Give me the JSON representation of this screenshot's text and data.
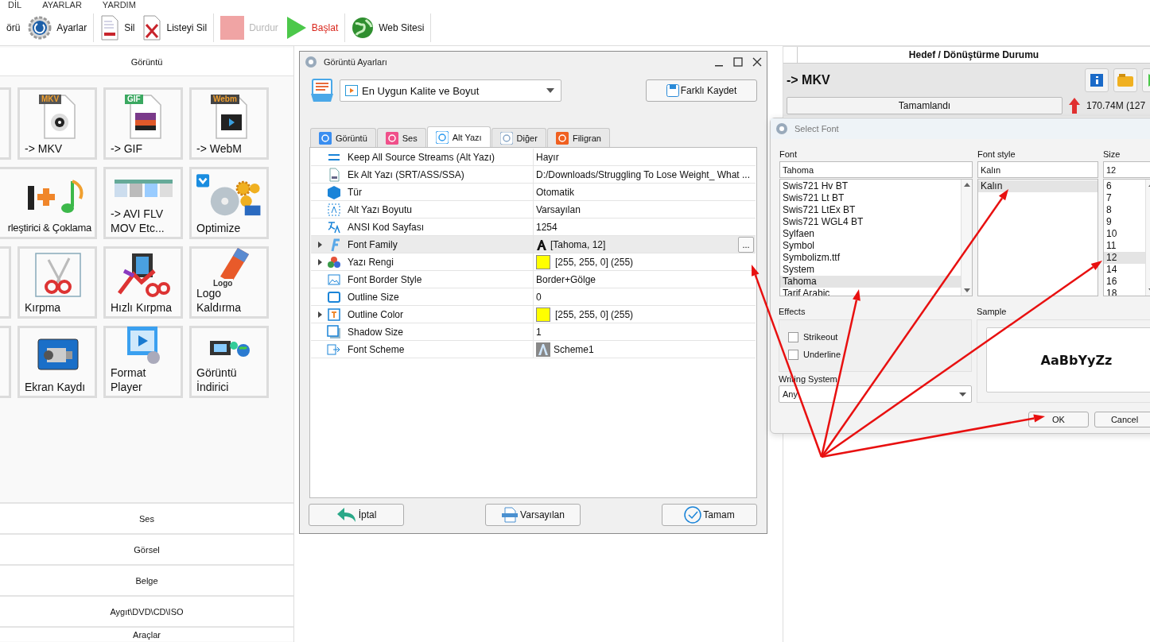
{
  "menu": [
    "DİL",
    "AYARLAR",
    "YARDIM"
  ],
  "toolbar": [
    [
      {
        "kind": "cut",
        "label": "örü",
        "disabled": false,
        "highlighted": false
      },
      {
        "kind": "settings",
        "label": "Ayarlar",
        "disabled": false,
        "highlighted": false
      }
    ],
    [
      {
        "kind": "delete",
        "label": "Sil",
        "disabled": false,
        "highlighted": false
      },
      {
        "kind": "clear",
        "label": "Listeyi Sil",
        "disabled": false,
        "highlighted": false
      }
    ],
    [
      {
        "kind": "stop",
        "label": "Durdur",
        "disabled": true,
        "highlighted": false
      },
      {
        "kind": "start",
        "label": "Başlat",
        "disabled": false,
        "highlighted": true
      }
    ],
    [
      {
        "kind": "web",
        "label": "Web Sitesi",
        "disabled": false,
        "highlighted": false
      }
    ]
  ],
  "left_panel": {
    "header": "Görüntü",
    "tiles": [
      {
        "kind": "partial"
      },
      {
        "kind": "mkv",
        "badge": "MKV",
        "lines": [
          "-> MKV"
        ]
      },
      {
        "kind": "gif",
        "badge": "GIF",
        "lines": [
          "-> GIF"
        ]
      },
      {
        "kind": "webm",
        "badge": "Webm",
        "lines": [
          "-> WebM"
        ]
      },
      {
        "kind": "merge",
        "lines": [
          "rleştirici & Çoklama"
        ]
      },
      {
        "kind": "avi",
        "lines": [
          "-> AVI FLV",
          "MOV Etc..."
        ]
      },
      {
        "kind": "optimize",
        "lines": [
          "Optimize"
        ]
      },
      {
        "kind": "partial"
      },
      {
        "kind": "crop",
        "lines": [
          "Kırpma"
        ]
      },
      {
        "kind": "fastcrop",
        "lines": [
          "Hızlı Kırpma"
        ]
      },
      {
        "kind": "logo",
        "badge": "Logo",
        "lines": [
          "Logo",
          "Kaldırma"
        ]
      },
      {
        "kind": "partial"
      },
      {
        "kind": "record",
        "lines": [
          "Ekran Kaydı"
        ]
      },
      {
        "kind": "player",
        "lines": [
          "Format",
          "Player"
        ]
      },
      {
        "kind": "download",
        "lines": [
          "Görüntü",
          "İndirici"
        ]
      }
    ],
    "categories": [
      "Ses",
      "Görsel",
      "Belge",
      "Aygıt\\DVD\\CD\\ISO",
      "Araçlar"
    ]
  },
  "target_panel": {
    "header": "Hedef / Dönüştürme Durumu",
    "title": "-> MKV",
    "status": "Tamamlandı",
    "size": "170.74M  (127"
  },
  "settings_dialog": {
    "title": "Görüntü Ayarları",
    "profile": "En Uygun Kalite ve Boyut",
    "save_as": "Farklı Kaydet",
    "tabs": [
      {
        "label": "Görüntü",
        "selected": false
      },
      {
        "label": "Ses",
        "selected": false
      },
      {
        "label": "Alt Yazı",
        "selected": true
      },
      {
        "label": "Diğer",
        "selected": false
      },
      {
        "label": "Filigran",
        "selected": false
      }
    ],
    "properties": [
      {
        "name": "Keep All Source Streams (Alt Yazı)",
        "value": "Hayır",
        "kind": "text",
        "expandable": false,
        "selected": false
      },
      {
        "name": "Ek Alt Yazı (SRT/ASS/SSA)",
        "value": "D:/Downloads/Struggling To Lose Weight_ What ...",
        "kind": "text",
        "expandable": false,
        "selected": false
      },
      {
        "name": "Tür",
        "value": "Otomatik",
        "kind": "text",
        "expandable": false,
        "selected": false
      },
      {
        "name": "Alt Yazı Boyutu",
        "value": "Varsayılan",
        "kind": "text",
        "expandable": false,
        "selected": false
      },
      {
        "name": "ANSI Kod Sayfası",
        "value": "1254",
        "kind": "text",
        "expandable": false,
        "selected": false
      },
      {
        "name": "Font Family",
        "value": "[Tahoma, 12]",
        "kind": "font",
        "expandable": true,
        "selected": true
      },
      {
        "name": "Yazı Rengi",
        "value": "[255, 255, 0] (255)",
        "kind": "color",
        "color": "#ffff00",
        "expandable": true,
        "selected": false
      },
      {
        "name": "Font Border Style",
        "value": "Border+Gölge",
        "kind": "text",
        "expandable": false,
        "selected": false
      },
      {
        "name": "Outline Size",
        "value": "0",
        "kind": "text",
        "expandable": false,
        "selected": false
      },
      {
        "name": "Outline Color",
        "value": "[255, 255, 0] (255)",
        "kind": "color",
        "color": "#ffff00",
        "expandable": true,
        "selected": false
      },
      {
        "name": "Shadow Size",
        "value": "1",
        "kind": "text",
        "expandable": false,
        "selected": false
      },
      {
        "name": "Font Scheme",
        "value": "Scheme1",
        "kind": "scheme",
        "expandable": false,
        "selected": false
      }
    ],
    "edit_button": "...",
    "buttons": [
      {
        "kind": "cancel",
        "label": "İptal"
      },
      {
        "kind": "default",
        "label": "Varsayılan"
      },
      {
        "kind": "ok",
        "label": "Tamam"
      }
    ]
  },
  "font_dialog": {
    "title": "Select Font",
    "font": {
      "label": "Font",
      "value": "Tahoma",
      "items": [
        {
          "label": "Swis721 Hv BT",
          "selected": false
        },
        {
          "label": "Swis721 Lt BT",
          "selected": false
        },
        {
          "label": "Swis721 LtEx BT",
          "selected": false
        },
        {
          "label": "Swis721 WGL4 BT",
          "selected": false
        },
        {
          "label": "Sylfaen",
          "selected": false
        },
        {
          "label": "Symbol",
          "selected": false
        },
        {
          "label": "Symbolizm.ttf",
          "selected": false
        },
        {
          "label": "System",
          "selected": false
        },
        {
          "label": "Tahoma",
          "selected": true
        },
        {
          "label": "Tarif Arabic",
          "selected": false
        }
      ]
    },
    "style": {
      "label": "Font style",
      "value": "Kalın",
      "items": [
        {
          "label": "Kalın",
          "selected": true
        }
      ]
    },
    "size": {
      "label": "Size",
      "value": "12",
      "items": [
        {
          "label": "6",
          "selected": false
        },
        {
          "label": "7",
          "selected": false
        },
        {
          "label": "8",
          "selected": false
        },
        {
          "label": "9",
          "selected": false
        },
        {
          "label": "10",
          "selected": false
        },
        {
          "label": "11",
          "selected": false
        },
        {
          "label": "12",
          "selected": true
        },
        {
          "label": "14",
          "selected": false
        },
        {
          "label": "16",
          "selected": false
        },
        {
          "label": "18",
          "selected": false
        }
      ]
    },
    "effects": {
      "label": "Effects",
      "options": [
        {
          "label": "Strikeout",
          "checked": false
        },
        {
          "label": "Underline",
          "checked": false
        }
      ]
    },
    "writing_system": {
      "label": "Writing System",
      "value": "Any"
    },
    "sample": {
      "label": "Sample",
      "text": "AaBbYyZz"
    },
    "buttons": [
      "OK",
      "Cancel"
    ]
  }
}
